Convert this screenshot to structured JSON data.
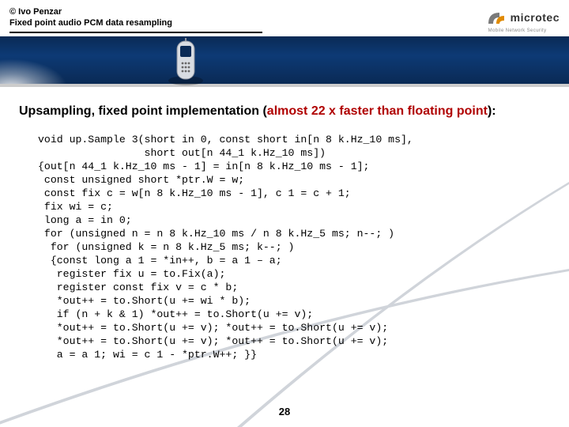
{
  "header": {
    "copyright": "© Ivo Penzar",
    "subtitle": "Fixed point audio PCM data resampling"
  },
  "logo": {
    "brand": "microtec",
    "tagline": "Mobile Network Security"
  },
  "title": {
    "lead": "Upsampling, fixed point implementation (",
    "red": "almost 22 x faster than floating point",
    "tail": "):"
  },
  "code": {
    "l01": "void up.Sample 3(short in 0, const short in[n 8 k.Hz_10 ms],",
    "l02": "                 short out[n 44_1 k.Hz_10 ms])",
    "l03": "{out[n 44_1 k.Hz_10 ms - 1] = in[n 8 k.Hz_10 ms - 1];",
    "l04": " const unsigned short *ptr.W = w;",
    "l05": " const fix c = w[n 8 k.Hz_10 ms - 1], c 1 = c + 1;",
    "l06": " fix wi = c;",
    "l07": " long a = in 0;",
    "l08": " for (unsigned n = n 8 k.Hz_10 ms / n 8 k.Hz_5 ms; n--; )",
    "l09": "  for (unsigned k = n 8 k.Hz_5 ms; k--; )",
    "l10": "  {const long a 1 = *in++, b = a 1 – a;",
    "l11": "   register fix u = to.Fix(a);",
    "l12": "   register const fix v = c * b;",
    "l13": "   *out++ = to.Short(u += wi * b);",
    "l14": "   if (n + k & 1) *out++ = to.Short(u += v);",
    "l15": "   *out++ = to.Short(u += v); *out++ = to.Short(u += v);",
    "l16": "   *out++ = to.Short(u += v); *out++ = to.Short(u += v);",
    "l17": "   a = a 1; wi = c 1 - *ptr.W++; }}"
  },
  "page": "28"
}
